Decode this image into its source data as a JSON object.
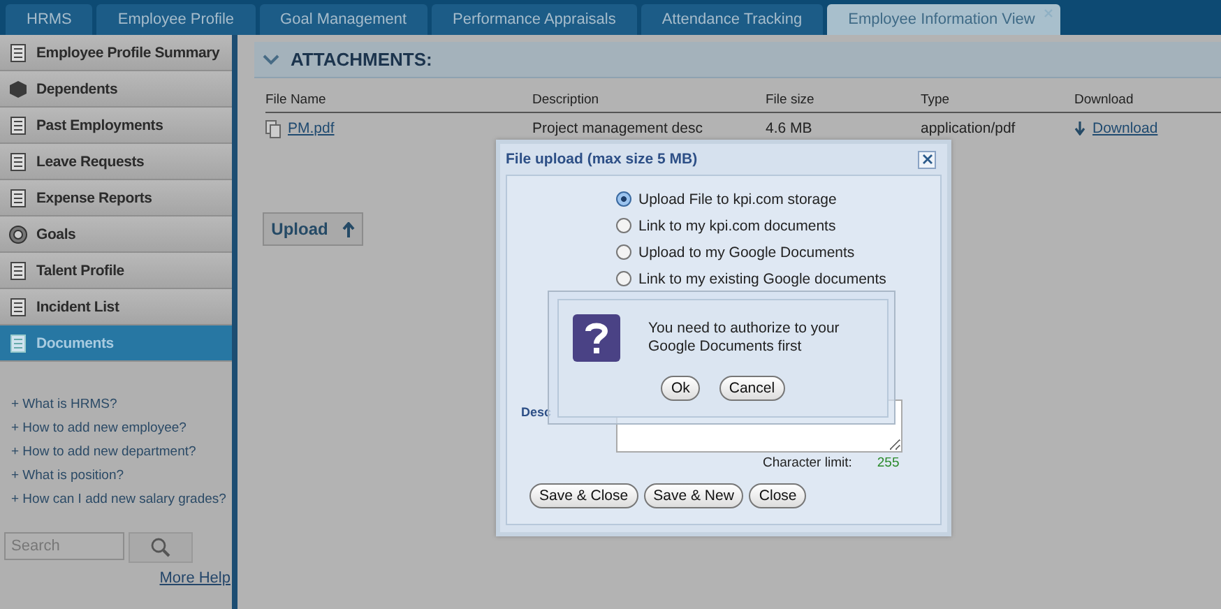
{
  "tabs": [
    {
      "label": "HRMS",
      "selected": false
    },
    {
      "label": "Employee Profile",
      "selected": false
    },
    {
      "label": "Goal Management",
      "selected": false
    },
    {
      "label": "Performance Appraisals",
      "selected": false
    },
    {
      "label": "Attendance Tracking",
      "selected": false
    },
    {
      "label": "Employee Information View",
      "selected": true
    }
  ],
  "sidebar": {
    "items": [
      {
        "label": "Employee Profile Summary",
        "selected": false
      },
      {
        "label": "Dependents",
        "selected": false
      },
      {
        "label": "Past Employments",
        "selected": false
      },
      {
        "label": "Leave Requests",
        "selected": false
      },
      {
        "label": "Expense Reports",
        "selected": false
      },
      {
        "label": "Goals",
        "selected": false
      },
      {
        "label": "Talent Profile",
        "selected": false
      },
      {
        "label": "Incident List",
        "selected": false
      },
      {
        "label": "Documents",
        "selected": true
      }
    ],
    "help_links": [
      "+ What is HRMS?",
      "+ How to add new employee?",
      "+ How to add new department?",
      "+ What is position?",
      "+ How can I add new salary grades?"
    ],
    "search": {
      "placeholder": "Search"
    },
    "more_help": "More Help"
  },
  "section": {
    "title": "ATTACHMENTS:"
  },
  "table": {
    "columns": [
      "File Name",
      "Description",
      "File size",
      "Type",
      "Download"
    ],
    "rows": [
      {
        "file_name": "PM.pdf",
        "description": "Project management desc",
        "file_size": "4.6 MB",
        "type": "application/pdf",
        "download": "Download"
      }
    ]
  },
  "upload_button": "Upload",
  "dialog": {
    "title": "File upload (max size 5 MB)",
    "options": [
      {
        "label": "Upload File to kpi.com storage",
        "selected": true
      },
      {
        "label": "Link to my kpi.com documents",
        "selected": false
      },
      {
        "label": "Upload to my Google Documents",
        "selected": false
      },
      {
        "label": "Link to my existing Google documents",
        "selected": false
      }
    ],
    "description_label": "Desc",
    "char_limit_label": "Character limit:",
    "char_limit": "255",
    "buttons": [
      "Save & Close",
      "Save & New",
      "Close"
    ]
  },
  "alert": {
    "message": "You need to authorize to your Google Documents first",
    "buttons": [
      "Ok",
      "Cancel"
    ]
  }
}
